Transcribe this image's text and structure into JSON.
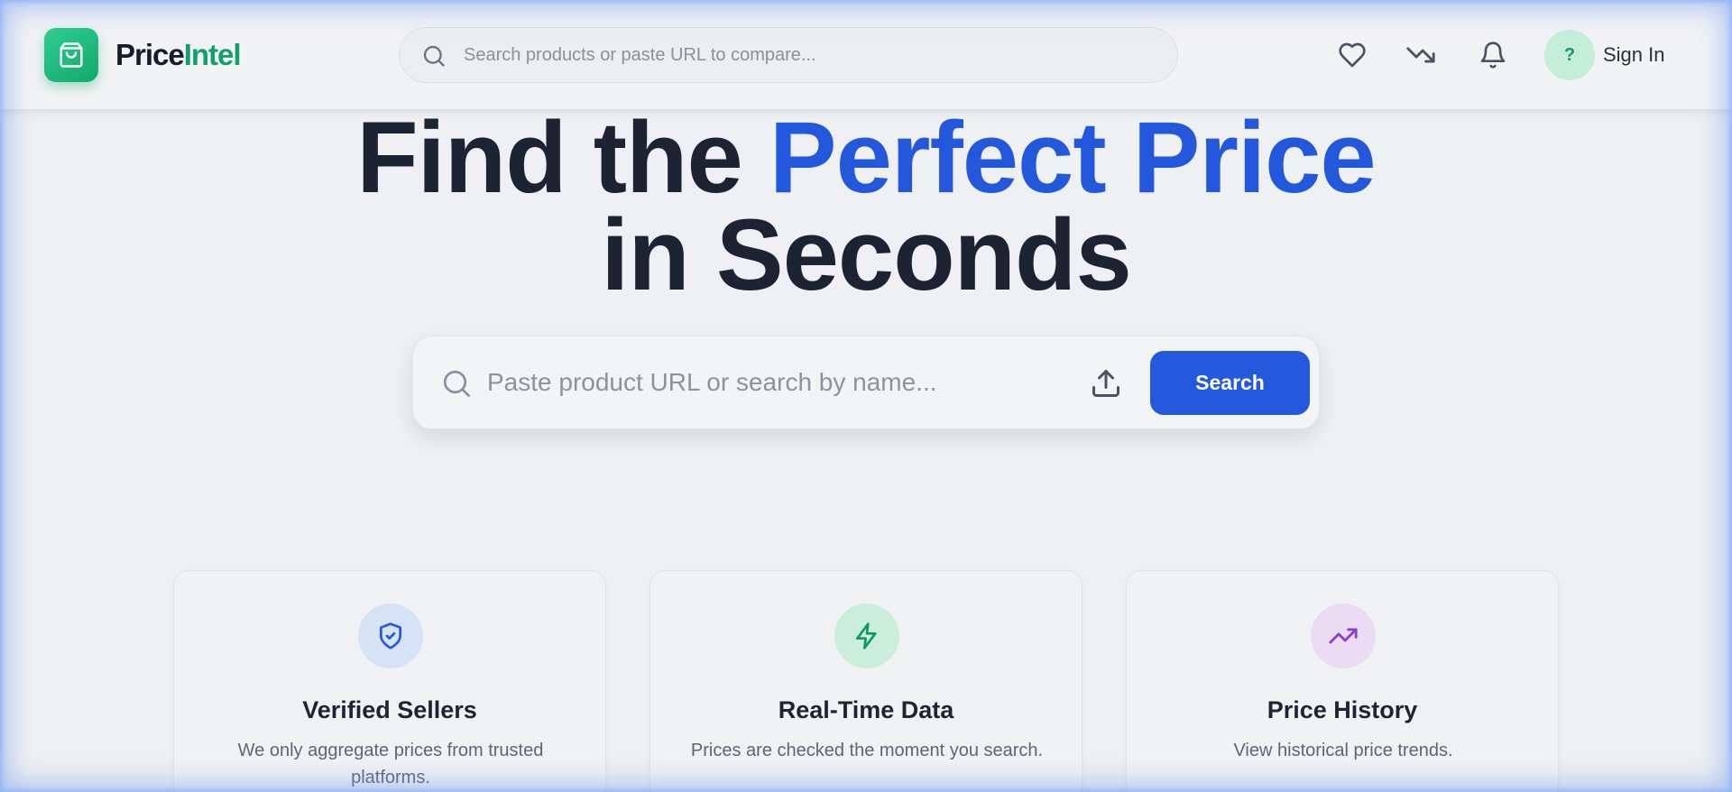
{
  "brand": {
    "name_part1": "Price",
    "name_part2": "Intel"
  },
  "header": {
    "search_placeholder": "Search products or paste URL to compare...",
    "avatar_label": "?",
    "sign_in_label": "Sign In"
  },
  "hero": {
    "title_line1_plain": "Find the ",
    "title_line1_accent": "Perfect Price",
    "title_line2": "in Seconds",
    "search_placeholder": "Paste product URL or search by name...",
    "search_button_label": "Search"
  },
  "features": [
    {
      "title": "Verified Sellers",
      "description": "We only aggregate prices from trusted platforms.",
      "icon": "shield-check-icon"
    },
    {
      "title": "Real-Time Data",
      "description": "Prices are checked the moment you search.",
      "icon": "lightning-icon"
    },
    {
      "title": "Price History",
      "description": "View historical price trends.",
      "icon": "trending-up-icon"
    }
  ],
  "colors": {
    "brand_green": "#13a06a",
    "accent_blue": "#2458dc",
    "text_dark": "#1c2333"
  }
}
